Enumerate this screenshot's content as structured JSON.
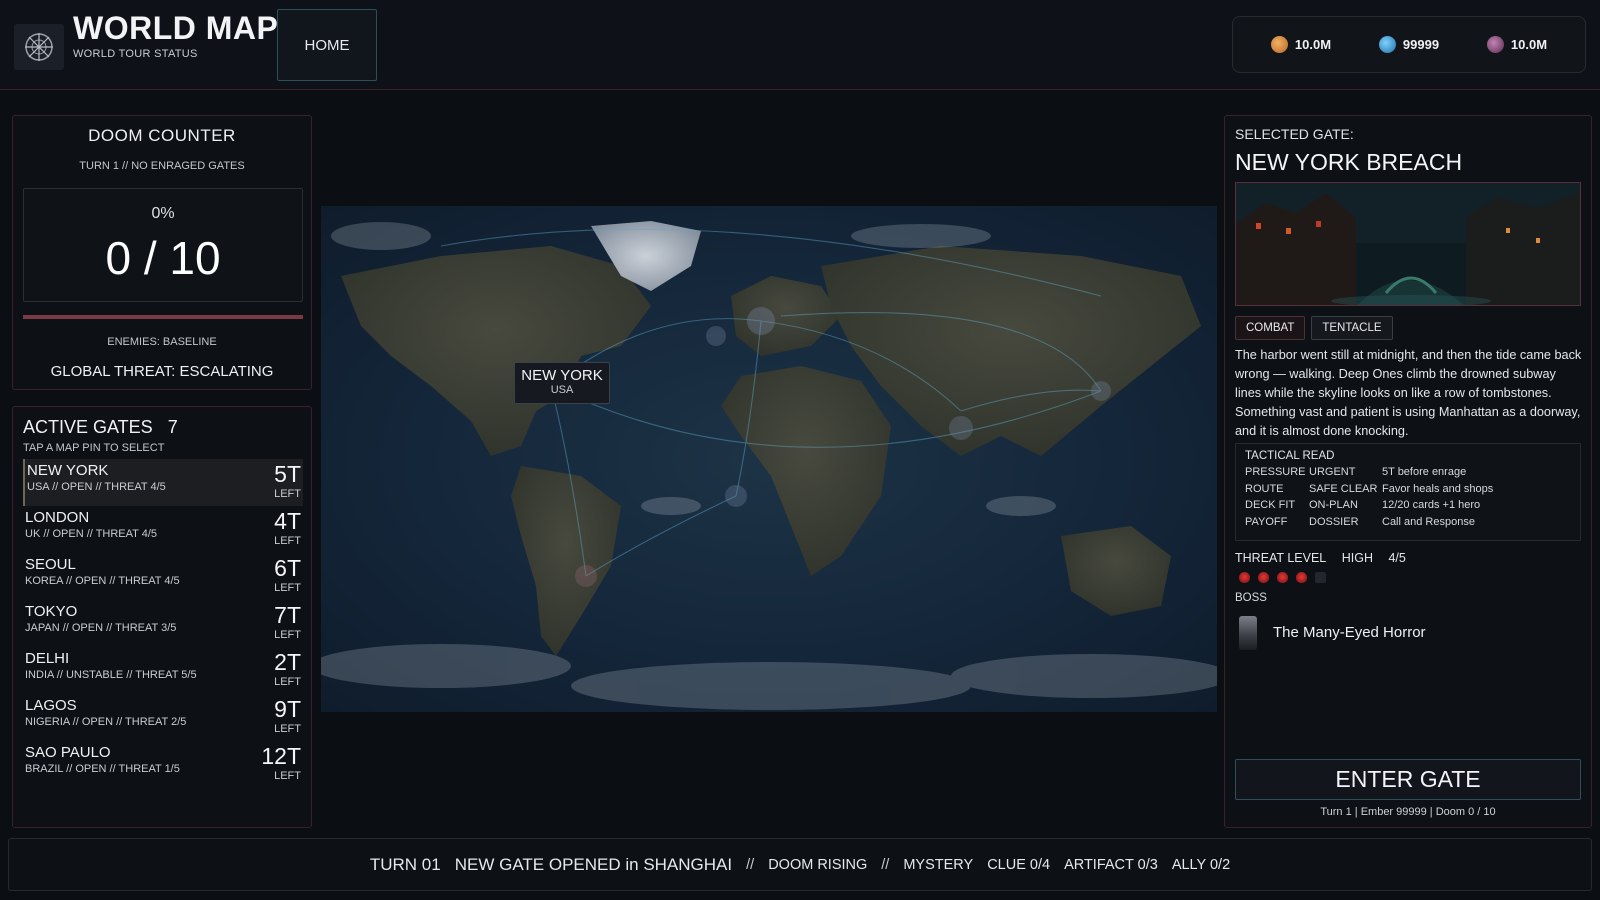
{
  "header": {
    "title": "WORLD MAP",
    "subtitle": "WORLD TOUR STATUS",
    "home_label": "HOME",
    "currencies": [
      {
        "icon": "ember-coin-icon",
        "value": "10.0M",
        "color": "#d98a3e"
      },
      {
        "icon": "crystal-coin-icon",
        "value": "99999",
        "color": "#3aa0d8"
      },
      {
        "icon": "soul-coin-icon",
        "value": "10.0M",
        "color": "#8a4a7a"
      }
    ]
  },
  "doom": {
    "title": "DOOM COUNTER",
    "subtitle": "TURN 1 // NO ENRAGED GATES",
    "percent": "0%",
    "value": "0 / 10",
    "progress": 0,
    "enemies": "ENEMIES: BASELINE",
    "threat": "GLOBAL THREAT: ESCALATING"
  },
  "gates": {
    "title": "ACTIVE GATES",
    "count": "7",
    "hint": "TAP A MAP PIN TO SELECT",
    "left_label": "LEFT",
    "items": [
      {
        "name": "NEW YORK",
        "meta": "USA // OPEN // THREAT 4/5",
        "turns": "5T",
        "selected": true
      },
      {
        "name": "LONDON",
        "meta": "UK // OPEN // THREAT 4/5",
        "turns": "4T",
        "selected": false
      },
      {
        "name": "SEOUL",
        "meta": "KOREA // OPEN // THREAT 4/5",
        "turns": "6T",
        "selected": false
      },
      {
        "name": "TOKYO",
        "meta": "JAPAN // OPEN // THREAT 3/5",
        "turns": "7T",
        "selected": false
      },
      {
        "name": "DELHI",
        "meta": "INDIA // UNSTABLE // THREAT 5/5",
        "turns": "2T",
        "selected": false
      },
      {
        "name": "LAGOS",
        "meta": "NIGERIA // OPEN // THREAT 2/5",
        "turns": "9T",
        "selected": false
      },
      {
        "name": "SAO PAULO",
        "meta": "BRAZIL // OPEN // THREAT 1/5",
        "turns": "12T",
        "selected": false
      }
    ]
  },
  "map": {
    "tooltip_city": "NEW YORK",
    "tooltip_country": "USA"
  },
  "selected": {
    "label": "SELECTED GATE:",
    "name": "NEW YORK BREACH",
    "tags": [
      "COMBAT",
      "TENTACLE"
    ],
    "description": "The harbor went still at midnight, and then the tide came back wrong — walking. Deep Ones climb the drowned subway lines while the skyline looks on like a row of tombstones. Something vast and patient is using Manhattan as a doorway, and it is almost done knocking.",
    "tactical_title": "TACTICAL READ",
    "tactical": [
      {
        "key": "PRESSURE",
        "value": "URGENT",
        "note": "5T before enrage"
      },
      {
        "key": "ROUTE",
        "value": "SAFE CLEAR",
        "note": "Favor heals and shops"
      },
      {
        "key": "DECK FIT",
        "value": "ON-PLAN",
        "note": "12/20 cards  +1 hero"
      },
      {
        "key": "PAYOFF",
        "value": "DOSSIER",
        "note": "Call and Response"
      }
    ],
    "threat_label": "THREAT LEVEL",
    "threat_word": "HIGH",
    "threat_score": "4/5",
    "threat_level": 4,
    "threat_max": 5,
    "boss_label": "BOSS",
    "boss_name": "The Many-Eyed Horror",
    "enter_label": "ENTER GATE",
    "footer": "Turn 1  |  Ember 99999  |  Doom 0 / 10"
  },
  "ticker": {
    "turn": "TURN 01",
    "headline": "NEW GATE OPENED in SHANGHAI",
    "sep": "//",
    "status": "DOOM RISING",
    "mystery_label": "MYSTERY",
    "clue": "CLUE 0/4",
    "artifact": "ARTIFACT 0/3",
    "ally": "ALLY 0/2"
  }
}
